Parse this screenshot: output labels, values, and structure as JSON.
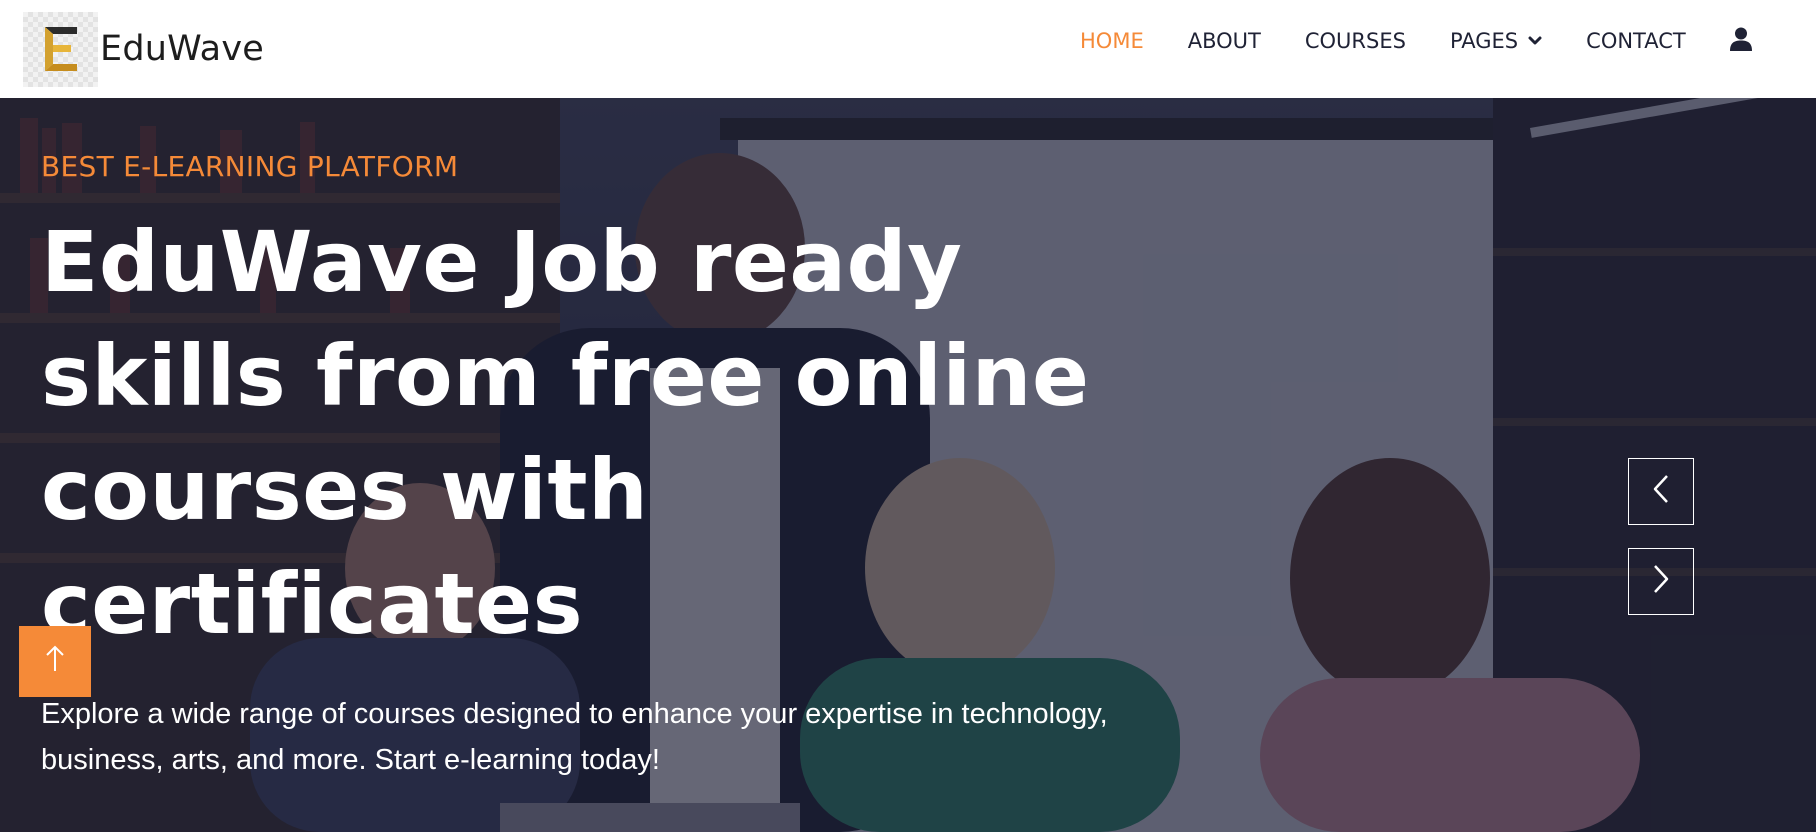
{
  "brand": {
    "name": "EduWave",
    "logo_icon": "eduwave-e-logo-icon"
  },
  "nav": {
    "items": [
      {
        "label": "HOME",
        "active": true
      },
      {
        "label": "ABOUT",
        "active": false
      },
      {
        "label": "COURSES",
        "active": false
      },
      {
        "label": "PAGES",
        "active": false,
        "has_dropdown": true,
        "icon": "chevron-down-icon"
      },
      {
        "label": "CONTACT",
        "active": false
      }
    ],
    "account_icon": "user-icon"
  },
  "hero": {
    "eyebrow": "BEST E-LEARNING PLATFORM",
    "title": "EduWave Job ready skills from free online courses with certificates",
    "description": "Explore a wide range of courses designed to enhance your expertise in technology, business, arts, and more. Start e-learning today!",
    "prev_icon": "chevron-left-icon",
    "next_icon": "chevron-right-icon"
  },
  "back_to_top": {
    "icon": "arrow-up-icon"
  },
  "colors": {
    "accent": "#f58a38",
    "nav_text": "#1f2235",
    "hero_overlay": "#161830",
    "white": "#ffffff"
  }
}
